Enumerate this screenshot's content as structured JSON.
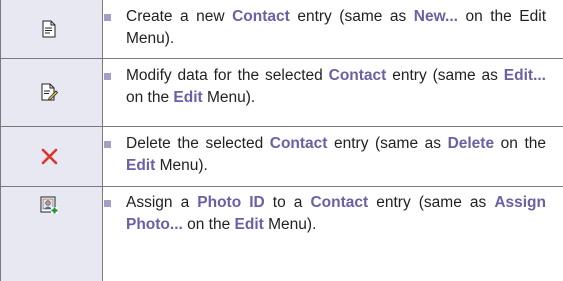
{
  "rows": [
    {
      "icon": "new-document-icon",
      "parts": [
        {
          "t": "Create a new ",
          "kw": false
        },
        {
          "t": "Contact",
          "kw": true
        },
        {
          "t": " entry (same as ",
          "kw": false
        },
        {
          "t": "New...",
          "kw": true
        },
        {
          "t": " on the Edit Menu).",
          "kw": false
        }
      ]
    },
    {
      "icon": "edit-document-icon",
      "parts": [
        {
          "t": "Modify data for the selected ",
          "kw": false
        },
        {
          "t": "Contact",
          "kw": true
        },
        {
          "t": " entry (same as ",
          "kw": false
        },
        {
          "t": "Edit...",
          "kw": true
        },
        {
          "t": " on the ",
          "kw": false
        },
        {
          "t": "Edit",
          "kw": true
        },
        {
          "t": " Menu).",
          "kw": false
        }
      ]
    },
    {
      "icon": "delete-x-icon",
      "parts": [
        {
          "t": "Delete the selected ",
          "kw": false
        },
        {
          "t": "Contact",
          "kw": true
        },
        {
          "t": " entry (same as ",
          "kw": false
        },
        {
          "t": "Delete",
          "kw": true
        },
        {
          "t": " on the ",
          "kw": false
        },
        {
          "t": "Edit",
          "kw": true
        },
        {
          "t": " Menu).",
          "kw": false
        }
      ]
    },
    {
      "icon": "assign-photo-icon",
      "parts": [
        {
          "t": "Assign a ",
          "kw": false
        },
        {
          "t": "Photo ID",
          "kw": true
        },
        {
          "t": " to a ",
          "kw": false
        },
        {
          "t": "Contact",
          "kw": true
        },
        {
          "t": " entry (same as ",
          "kw": false
        },
        {
          "t": "Assign Photo...",
          "kw": true
        },
        {
          "t": " on the ",
          "kw": false
        },
        {
          "t": "Edit",
          "kw": true
        },
        {
          "t": " Menu).",
          "kw": false
        }
      ]
    }
  ],
  "colors": {
    "keyword": "#6b5fa6",
    "bullet": "#a39fc9",
    "icon_bg": "#e7e8f1",
    "delete_red": "#e0322b"
  }
}
